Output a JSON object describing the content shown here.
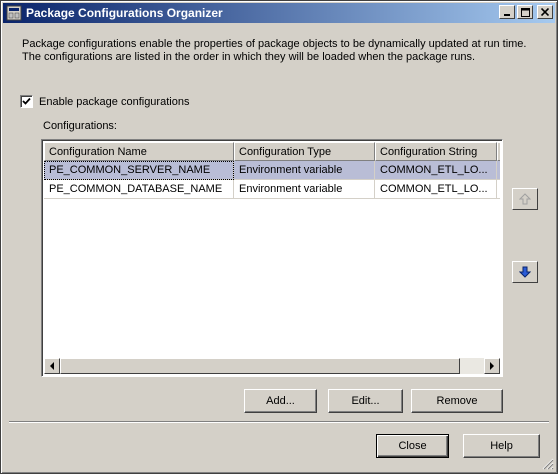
{
  "window": {
    "title": "Package Configurations Organizer",
    "controls": {
      "minimize": "_",
      "maximize": "□",
      "close": "X"
    }
  },
  "description": {
    "line1": "Package configurations enable the properties of package objects to be dynamically updated at run time.",
    "line2": "The configurations are listed in the order in which they will be loaded when the package runs."
  },
  "enable_checkbox": {
    "label": "Enable package configurations",
    "checked": true
  },
  "configurations_label": "Configurations:",
  "table": {
    "columns": [
      "Configuration Name",
      "Configuration Type",
      "Configuration String",
      "T"
    ],
    "rows": [
      {
        "name": "PE_COMMON_SERVER_NAME",
        "type": "Environment variable",
        "string": "COMMON_ETL_LO..."
      },
      {
        "name": "PE_COMMON_DATABASE_NAME",
        "type": "Environment variable",
        "string": "COMMON_ETL_LO..."
      }
    ],
    "selected_row": 0
  },
  "reorder_buttons": {
    "up_icon": "arrow-up-icon",
    "down_icon": "arrow-down-icon"
  },
  "action_buttons": {
    "add": "Add...",
    "edit": "Edit...",
    "remove": "Remove"
  },
  "footer_buttons": {
    "close": "Close",
    "help": "Help"
  },
  "colors": {
    "title_start": "#0a246a",
    "title_end": "#a6caf0",
    "selection": "#b9bdd6",
    "face": "#d4d0c8"
  }
}
